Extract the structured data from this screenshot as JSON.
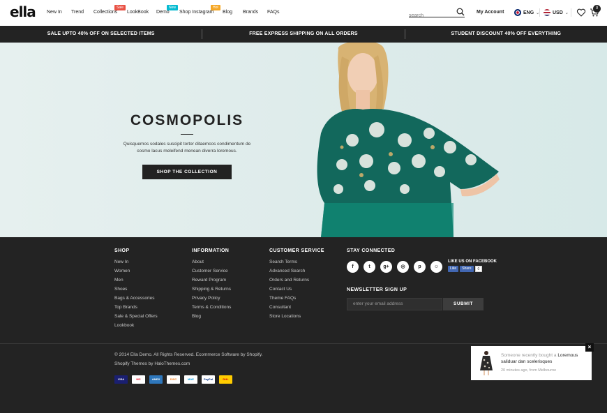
{
  "header": {
    "logo": "ella",
    "nav": [
      {
        "label": "New In"
      },
      {
        "label": "Trend"
      },
      {
        "label": "Collections",
        "badge": "Sale",
        "badge_color": "#e95144"
      },
      {
        "label": "LookBook"
      },
      {
        "label": "Demo",
        "badge": "New",
        "badge_color": "#06bbd1"
      },
      {
        "label": "Shop Instagram",
        "badge": "Hot",
        "badge_color": "#f5a623"
      },
      {
        "label": "Blog"
      },
      {
        "label": "Brands"
      },
      {
        "label": "FAQs"
      }
    ],
    "search_placeholder": "search",
    "account_label": "My Account",
    "language": "ENG",
    "currency": "USD",
    "cart_count": "0"
  },
  "promo": [
    "SALE UPTO 40% OFF ON SELECTED ITEMS",
    "FREE EXPRESS SHIPPING ON ALL ORDERS",
    "STUDENT DISCOUNT 40% OFF EVERYTHING"
  ],
  "hero": {
    "title": "COSMOPOLIS",
    "description": "Quisquemos sodales suscipit tortor ditaemcos condimentum de cosmo lacus meleifend menean diverra loremous.",
    "button": "SHOP THE COLLECTION"
  },
  "footer": {
    "shop": {
      "heading": "SHOP",
      "links": [
        "New In",
        "Women",
        "Men",
        "Shoes",
        "Bags & Accessories",
        "Top Brands",
        "Sale & Special Offers",
        "Lookbook"
      ]
    },
    "information": {
      "heading": "INFORMATION",
      "links": [
        "About",
        "Customer Service",
        "Reward Program",
        "Shipping & Returns",
        "Privacy Policy",
        "Terms & Conditions",
        "Blog"
      ]
    },
    "customer_service": {
      "heading": "CUSTOMER SERVICE",
      "links": [
        "Search Terms",
        "Advanced Search",
        "Orders and Returns",
        "Contact Us",
        "Theme FAQs",
        "Consultant",
        "Store Locations"
      ]
    },
    "stay_connected": {
      "heading": "STAY CONNECTED",
      "social_icons": [
        "facebook-icon",
        "twitter-icon",
        "google-plus-icon",
        "instagram-icon",
        "pinterest-icon",
        "snapchat-icon"
      ],
      "facebook_label": "LIKE US ON FACEBOOK",
      "fb_like": "Like",
      "fb_share": "Share",
      "fb_count": "0"
    },
    "newsletter": {
      "heading": "NEWSLETTER SIGN UP",
      "placeholder": "enter your email address",
      "button": "SUBMIT"
    },
    "copyright_line1": "© 2014 Ella Demo. All Rights Reserved. Ecommerce Software by Shopify.",
    "copyright_line2": "Shopify Themes by HaloThemes.com",
    "payments": [
      {
        "label": "VISA",
        "icon": "visa-icon",
        "bg": "#1a1f71",
        "fg": "#ffffff"
      },
      {
        "label": "MC",
        "icon": "mastercard-icon",
        "bg": "#ffffff",
        "fg": "#eb001b"
      },
      {
        "label": "AMEX",
        "icon": "amex-icon",
        "bg": "#2e77bc",
        "fg": "#ffffff"
      },
      {
        "label": "DISC",
        "icon": "discover-icon",
        "bg": "#ffffff",
        "fg": "#f48120"
      },
      {
        "label": "MAE",
        "icon": "maestro-icon",
        "bg": "#ffffff",
        "fg": "#0099df"
      },
      {
        "label": "PayPal",
        "icon": "paypal-icon",
        "bg": "#ffffff",
        "fg": "#003087"
      },
      {
        "label": "DHL",
        "icon": "dhl-icon",
        "bg": "#ffcc00",
        "fg": "#d40511"
      }
    ]
  },
  "popup": {
    "prefix": "Someone recently bought a",
    "product": "Loremous saliduar dan scelerisques",
    "meta": "20 minutes ago, from Melbourne"
  }
}
